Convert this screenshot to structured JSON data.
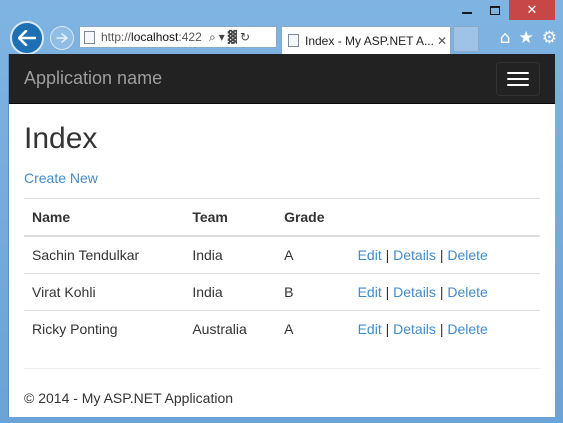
{
  "browser": {
    "url_prefix": "http://",
    "url_host": "localhost",
    "url_rest": ":422",
    "tab_title": "Index - My ASP.NET A...",
    "tab_close": "✕",
    "search_glyph": "⌕",
    "dropdown_glyph": "▾",
    "compat_glyph": "▓",
    "refresh_glyph": "↻",
    "home_glyph": "⌂",
    "favorites_glyph": "★",
    "tools_glyph": "⚙",
    "close_glyph": "✕"
  },
  "navbar": {
    "brand": "Application name"
  },
  "page": {
    "title": "Index",
    "create_link": "Create New",
    "columns": [
      "Name",
      "Team",
      "Grade"
    ],
    "rows": [
      {
        "name": "Sachin Tendulkar",
        "team": "India",
        "grade": "A"
      },
      {
        "name": "Virat Kohli",
        "team": "India",
        "grade": "B"
      },
      {
        "name": "Ricky Ponting",
        "team": "Australia",
        "grade": "A"
      }
    ],
    "actions": {
      "edit": "Edit",
      "details": "Details",
      "delete": "Delete",
      "separator": "|"
    },
    "footer": "© 2014 - My ASP.NET Application"
  },
  "colors": {
    "link": "#428bca",
    "navbar": "#222222",
    "back_button": "#1e6fb4",
    "close_button": "#c74646"
  }
}
